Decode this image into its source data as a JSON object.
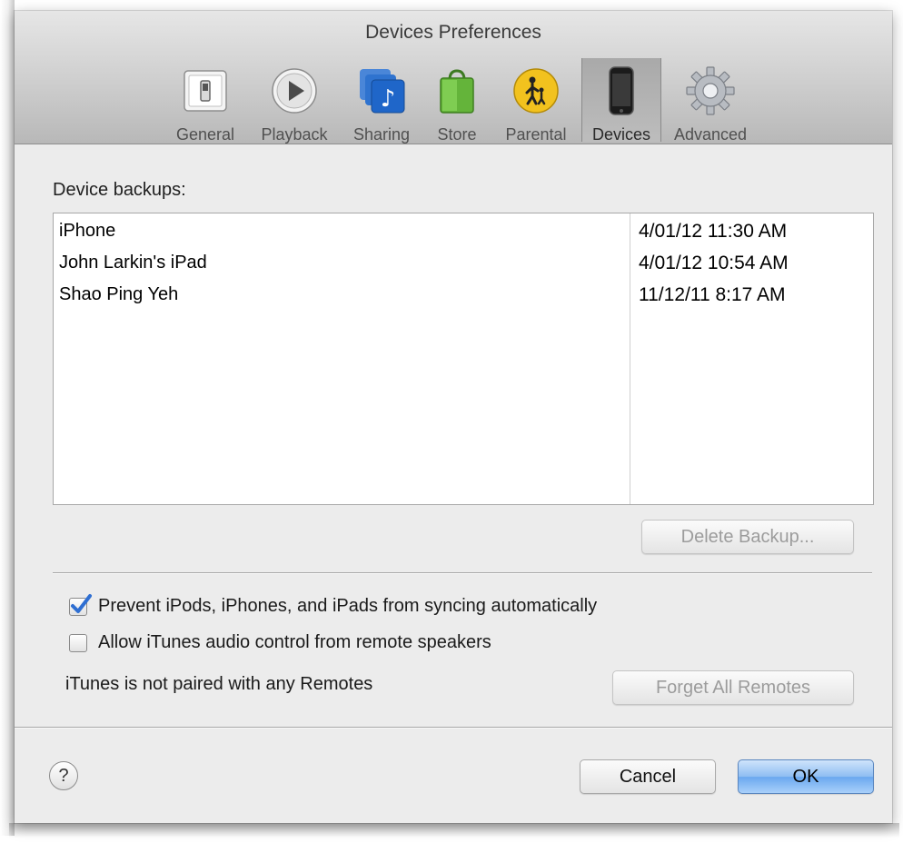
{
  "window": {
    "title": "Devices Preferences"
  },
  "toolbar": {
    "items": [
      {
        "label": "General",
        "icon": "switch-icon"
      },
      {
        "label": "Playback",
        "icon": "play-icon"
      },
      {
        "label": "Sharing",
        "icon": "music-note-icon"
      },
      {
        "label": "Store",
        "icon": "shopping-bag-icon"
      },
      {
        "label": "Parental",
        "icon": "parent-child-icon"
      },
      {
        "label": "Devices",
        "icon": "iphone-icon",
        "selected": true
      },
      {
        "label": "Advanced",
        "icon": "gear-icon"
      }
    ]
  },
  "backups": {
    "label": "Device backups:",
    "rows": [
      {
        "name": "iPhone",
        "date": "4/01/12 11:30 AM"
      },
      {
        "name": "John Larkin's iPad",
        "date": "4/01/12 10:54 AM"
      },
      {
        "name": "Shao Ping Yeh",
        "date": "11/12/11 8:17 AM"
      }
    ],
    "delete_button": "Delete Backup..."
  },
  "options": {
    "prevent_sync": {
      "label": "Prevent iPods, iPhones, and iPads from syncing automatically",
      "checked": true
    },
    "allow_audio_control": {
      "label": "Allow iTunes audio control from remote speakers",
      "checked": false
    },
    "remotes_status": "iTunes is not paired with any Remotes",
    "forget_button": "Forget All Remotes"
  },
  "footer": {
    "help": "?",
    "cancel": "Cancel",
    "ok": "OK"
  },
  "colors": {
    "accent_check": "#2f6fd2",
    "ok_button": "#7fb2f1"
  }
}
